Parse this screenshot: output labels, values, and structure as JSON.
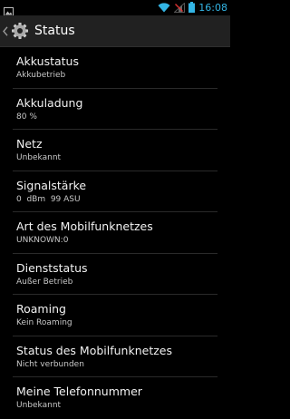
{
  "status_bar": {
    "time": "16:08",
    "icons": [
      "gallery-icon",
      "wifi-icon",
      "signal-icon",
      "battery-icon"
    ],
    "accent_color": "#33b5e5"
  },
  "action_bar": {
    "title": "Status",
    "icons": [
      "back-chevron-icon",
      "settings-gear-icon"
    ]
  },
  "items": [
    {
      "title": "Akkustatus",
      "summary": "Akkubetrieb"
    },
    {
      "title": "Akkuladung",
      "summary": "80 %"
    },
    {
      "title": "Netz",
      "summary": "Unbekannt"
    },
    {
      "title": "Signalstärke",
      "summary": "0  dBm  99 ASU"
    },
    {
      "title": "Art des Mobilfunknetzes",
      "summary": "UNKNOWN:0"
    },
    {
      "title": "Dienststatus",
      "summary": "Außer Betrieb"
    },
    {
      "title": "Roaming",
      "summary": "Kein Roaming"
    },
    {
      "title": "Status des Mobilfunknetzes",
      "summary": "Nicht verbunden"
    },
    {
      "title": "Meine Telefonnummer",
      "summary": "Unbekannt"
    }
  ]
}
